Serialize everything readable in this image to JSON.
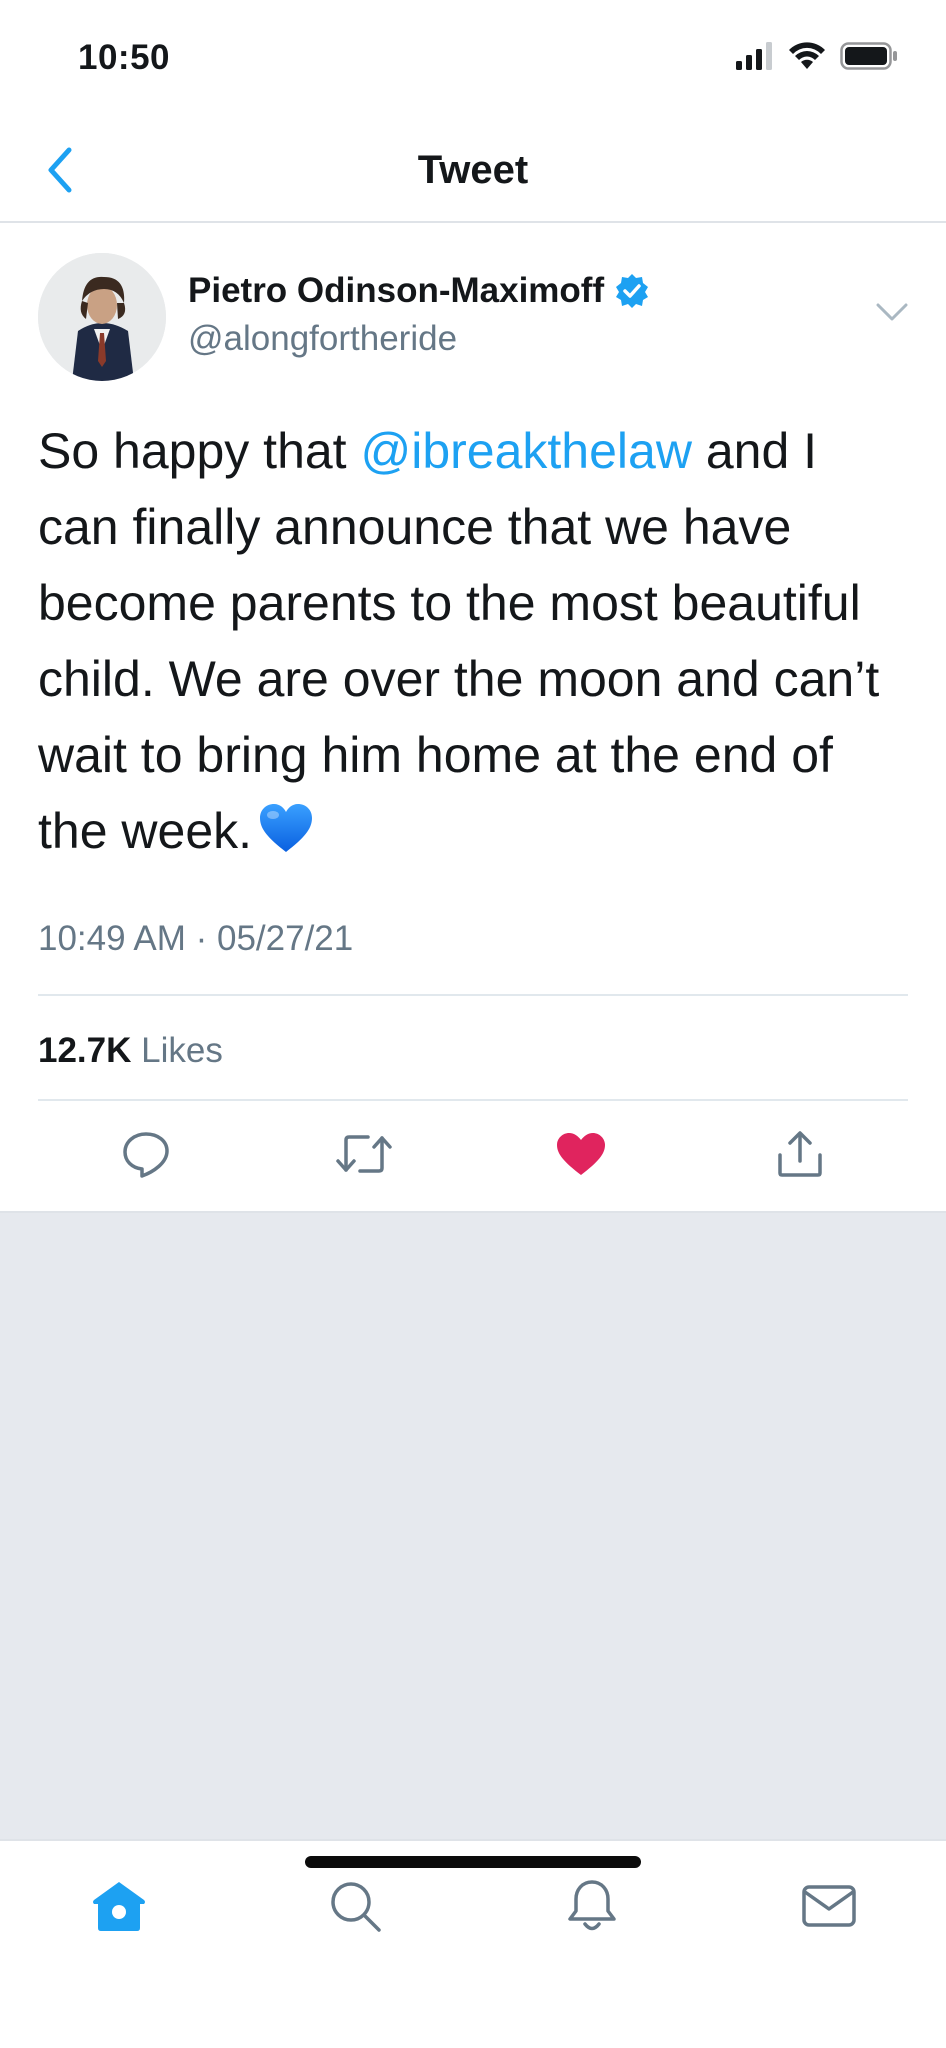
{
  "status_bar": {
    "time": "10:50",
    "icons": [
      "signal-icon",
      "wifi-icon",
      "battery-icon"
    ]
  },
  "header": {
    "title": "Tweet",
    "back_icon": "chevron-left-icon"
  },
  "tweet": {
    "author_name": "Pietro Odinson-Maximoff",
    "verified": true,
    "handle": "@alongfortheride",
    "text_before_mention": "So happy that ",
    "mention": "@ibreakthelaw",
    "text_after_mention": " and I can finally announce that we have become parents to the most beautiful child. We are over the moon and can’t wait to bring him home at the end of the week.",
    "emoji": "blue-heart-emoji",
    "timestamp": "10:49 AM · 05/27/21",
    "likes_count": "12.7K",
    "likes_label": "Likes",
    "liked": true
  },
  "actions": [
    "reply-icon",
    "retweet-icon",
    "like-icon",
    "share-icon"
  ],
  "tab_bar": [
    "home-icon",
    "search-icon",
    "notifications-icon",
    "messages-icon"
  ],
  "colors": {
    "accent": "#1da1f2",
    "like_active": "#e0245e",
    "secondary_text": "#657786",
    "gray_area": "#e6e9ee"
  }
}
